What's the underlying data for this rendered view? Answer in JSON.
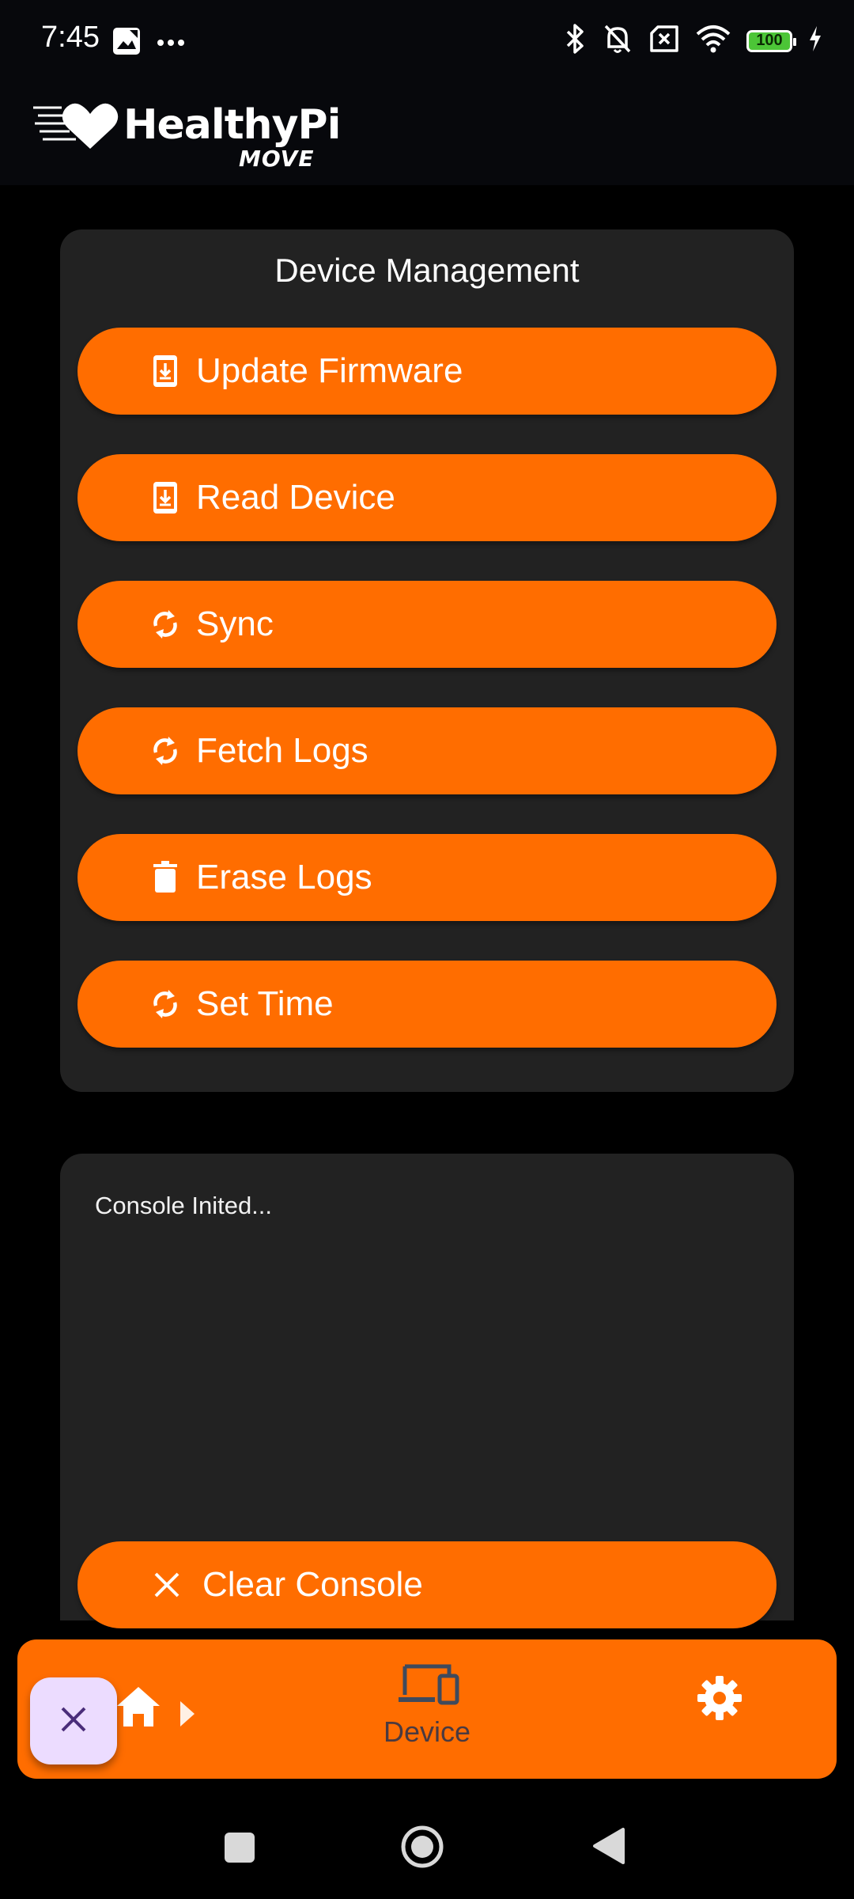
{
  "status_bar": {
    "time": "7:45",
    "battery": "100",
    "icons": [
      "photo-icon",
      "more-dots-icon",
      "bluetooth-icon",
      "bell-off-icon",
      "sim-off-icon",
      "wifi-icon",
      "battery-icon",
      "charging-bolt-icon"
    ]
  },
  "app_bar": {
    "logo_name": "HealthyPi",
    "logo_sub": "MOVE"
  },
  "device_management": {
    "title": "Device Management",
    "buttons": [
      {
        "label": "Update Firmware",
        "icon": "download-phone-icon"
      },
      {
        "label": "Read Device",
        "icon": "download-phone-icon"
      },
      {
        "label": "Sync",
        "icon": "sync-icon"
      },
      {
        "label": "Fetch Logs",
        "icon": "sync-icon"
      },
      {
        "label": "Erase Logs",
        "icon": "trash-icon"
      },
      {
        "label": "Set Time",
        "icon": "sync-icon"
      }
    ]
  },
  "console": {
    "text": "Console Inited...",
    "clear_label": "Clear Console"
  },
  "bottom_nav": {
    "items": [
      {
        "label": "",
        "icon": "home-icon"
      },
      {
        "label": "Device",
        "icon": "devices-icon"
      },
      {
        "label": "",
        "icon": "settings-gear-icon"
      }
    ]
  },
  "colors": {
    "accent": "#ff6d00",
    "card": "#222222",
    "background": "#000000",
    "fab": "#ecdcff",
    "nav_label": "#4b3a40"
  }
}
